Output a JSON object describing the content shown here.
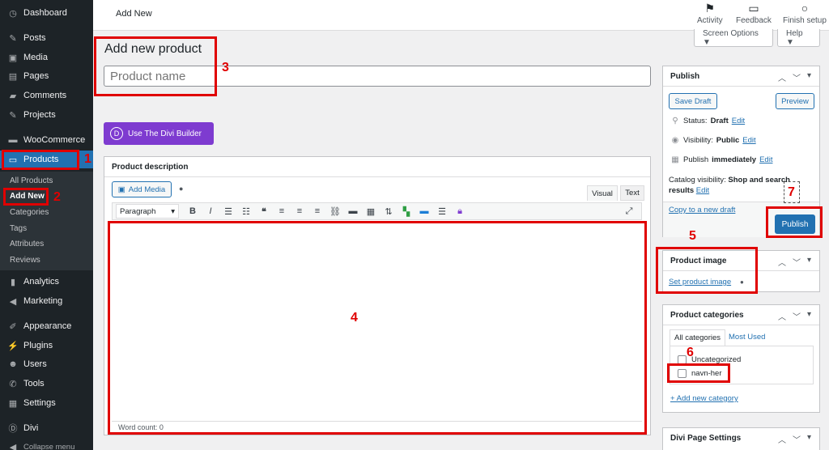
{
  "sidebar": {
    "items": [
      {
        "label": "Dashboard",
        "icon": "dashboard-icon",
        "glyph": "◷"
      },
      {
        "label": "Posts",
        "icon": "pin-icon",
        "glyph": "✎"
      },
      {
        "label": "Media",
        "icon": "media-icon",
        "glyph": "▣"
      },
      {
        "label": "Pages",
        "icon": "pages-icon",
        "glyph": "▤"
      },
      {
        "label": "Comments",
        "icon": "comments-icon",
        "glyph": "▰"
      },
      {
        "label": "Projects",
        "icon": "pin-icon",
        "glyph": "✎"
      },
      {
        "label": "WooCommerce",
        "icon": "woo-icon",
        "glyph": "▬"
      },
      {
        "label": "Products",
        "icon": "products-icon",
        "glyph": "▭"
      },
      {
        "label": "Analytics",
        "icon": "analytics-icon",
        "glyph": "▮"
      },
      {
        "label": "Marketing",
        "icon": "megaphone-icon",
        "glyph": "◀"
      },
      {
        "label": "Appearance",
        "icon": "brush-icon",
        "glyph": "✐"
      },
      {
        "label": "Plugins",
        "icon": "plug-icon",
        "glyph": "⚡"
      },
      {
        "label": "Users",
        "icon": "users-icon",
        "glyph": "☻"
      },
      {
        "label": "Tools",
        "icon": "wrench-icon",
        "glyph": "✆"
      },
      {
        "label": "Settings",
        "icon": "settings-icon",
        "glyph": "▦"
      },
      {
        "label": "Divi",
        "icon": "divi-icon",
        "glyph": "Ⓓ"
      },
      {
        "label": "Collapse menu",
        "icon": "collapse-icon",
        "glyph": "◀"
      }
    ],
    "submenu": [
      "All Products",
      "Add New",
      "Categories",
      "Tags",
      "Attributes",
      "Reviews"
    ]
  },
  "topbar": {
    "title": "Add New",
    "activity": "Activity",
    "feedback": "Feedback",
    "finish_setup": "Finish setup",
    "screen_options": "Screen Options ▼",
    "help": "Help ▼"
  },
  "main": {
    "page_title": "Add new product",
    "product_name_placeholder": "Product name",
    "divi_button": "Use The Divi Builder",
    "description": {
      "title": "Product description",
      "add_media": "Add Media",
      "tab_visual": "Visual",
      "tab_text": "Text",
      "format_select": "Paragraph",
      "word_count": "Word count: 0"
    }
  },
  "publish": {
    "title": "Publish",
    "save_draft": "Save Draft",
    "preview": "Preview",
    "status_label": "Status:",
    "status_value": "Draft",
    "visibility_label": "Visibility:",
    "visibility_value": "Public",
    "publish_label": "Publish",
    "publish_value": "immediately",
    "edit": "Edit",
    "catalog_label": "Catalog visibility:",
    "catalog_value": "Shop and search results",
    "copy_draft": "Copy to a new draft",
    "publish_button": "Publish"
  },
  "product_image": {
    "title": "Product image",
    "set_link": "Set product image"
  },
  "categories": {
    "title": "Product categories",
    "tab_all": "All categories",
    "tab_used": "Most Used",
    "items": [
      "Uncategorized",
      "navn-her"
    ],
    "add_link": "+ Add new category"
  },
  "divi_settings": {
    "title": "Divi Page Settings"
  },
  "annotations": [
    "1",
    "2",
    "3",
    "4",
    "5",
    "6",
    "7"
  ],
  "colors": {
    "accent": "#2271b1",
    "annotation": "#e00000",
    "divi": "#7e3bd0",
    "sidebar": "#1d2327"
  }
}
